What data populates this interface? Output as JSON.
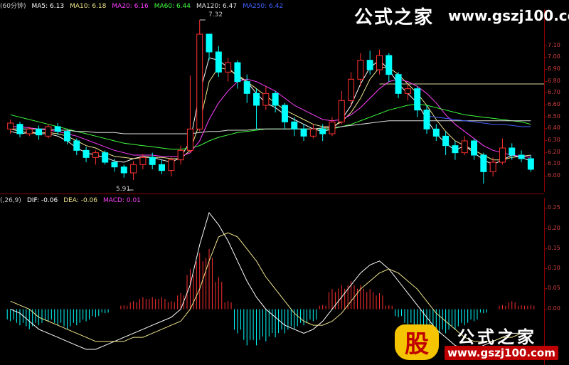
{
  "legend_top": {
    "period": "(60分钟)",
    "items": [
      {
        "label": "MA5: 6.13",
        "color": "#ffffff"
      },
      {
        "label": "MA10: 6.18",
        "color": "#f0e68c"
      },
      {
        "label": "MA20: 6.16",
        "color": "#ff40ff"
      },
      {
        "label": "MA60: 6.44",
        "color": "#40ff40"
      },
      {
        "label": "MA120: 6.47",
        "color": "#e0e0e0"
      },
      {
        "label": "MA250: 6.42",
        "color": "#4060ff"
      }
    ]
  },
  "legend_bottom": {
    "params": "(,26,9)",
    "items": [
      {
        "label": "DIF: -0.06",
        "color": "#ffffff"
      },
      {
        "label": "DEA: -0.06",
        "color": "#f0e68c"
      },
      {
        "label": "MACD: 0.01",
        "color": "#ff40ff"
      }
    ]
  },
  "annotations": {
    "high_label": "7.32",
    "low_label": "5.91"
  },
  "watermark_top": {
    "name": "公式之家",
    "url": "www.gszj100.com"
  },
  "watermark_bottom": {
    "badge": "股",
    "name": "公式之家",
    "url": "www.gszj100.com"
  },
  "colors": {
    "up": "#ff3030",
    "down": "#00ffff",
    "axis": "#8b0000"
  },
  "chart_data": [
    {
      "type": "candlestick",
      "title": "",
      "yticks": [
        "7.10",
        "7.00",
        "6.90",
        "6.80",
        "6.70",
        "6.60",
        "6.50",
        "6.40",
        "6.30",
        "6.20",
        "6.10",
        "6.00"
      ],
      "ylim": [
        5.88,
        7.38
      ],
      "series": [
        {
          "name": "MA5",
          "values": [
            6.38,
            6.36,
            6.37,
            6.36,
            6.36,
            6.34,
            6.3,
            6.24,
            6.2,
            6.18,
            6.16,
            6.13,
            6.12,
            6.15,
            6.17,
            6.16,
            6.14,
            6.12,
            6.16,
            6.3,
            6.7,
            7.0,
            6.98,
            6.92,
            6.84,
            6.8,
            6.7,
            6.62,
            6.58,
            6.52,
            6.48,
            6.44,
            6.4,
            6.38,
            6.4,
            6.48,
            6.6,
            6.78,
            6.92,
            6.98,
            6.9,
            6.78,
            6.7,
            6.62,
            6.48,
            6.36,
            6.28,
            6.22,
            6.26,
            6.2,
            6.14,
            6.1,
            6.14,
            6.18,
            6.16,
            6.13
          ]
        },
        {
          "name": "MA10",
          "values": [
            6.4,
            6.38,
            6.37,
            6.37,
            6.37,
            6.36,
            6.34,
            6.3,
            6.26,
            6.24,
            6.2,
            6.17,
            6.16,
            6.15,
            6.16,
            6.16,
            6.16,
            6.15,
            6.15,
            6.22,
            6.45,
            6.8,
            6.92,
            6.9,
            6.86,
            6.8,
            6.74,
            6.68,
            6.62,
            6.56,
            6.52,
            6.48,
            6.44,
            6.42,
            6.42,
            6.46,
            6.54,
            6.66,
            6.82,
            6.92,
            6.92,
            6.86,
            6.78,
            6.7,
            6.6,
            6.48,
            6.38,
            6.3,
            6.26,
            6.22,
            6.18,
            6.14,
            6.14,
            6.16,
            6.17,
            6.18
          ]
        },
        {
          "name": "MA20",
          "values": [
            6.42,
            6.42,
            6.41,
            6.4,
            6.39,
            6.38,
            6.36,
            6.34,
            6.31,
            6.28,
            6.25,
            6.22,
            6.2,
            6.18,
            6.18,
            6.18,
            6.17,
            6.17,
            6.17,
            6.2,
            6.3,
            6.48,
            6.62,
            6.72,
            6.8,
            6.82,
            6.8,
            6.76,
            6.72,
            6.66,
            6.6,
            6.56,
            6.52,
            6.48,
            6.47,
            6.48,
            6.52,
            6.58,
            6.66,
            6.74,
            6.8,
            6.82,
            6.8,
            6.76,
            6.7,
            6.62,
            6.52,
            6.44,
            6.38,
            6.32,
            6.26,
            6.22,
            6.2,
            6.18,
            6.17,
            6.16
          ]
        },
        {
          "name": "MA60",
          "values": [
            6.52,
            6.5,
            6.48,
            6.46,
            6.44,
            6.42,
            6.4,
            6.38,
            6.36,
            6.34,
            6.32,
            6.3,
            6.28,
            6.27,
            6.26,
            6.25,
            6.24,
            6.23,
            6.23,
            6.24,
            6.26,
            6.3,
            6.33,
            6.35,
            6.37,
            6.38,
            6.39,
            6.4,
            6.4,
            6.4,
            6.4,
            6.4,
            6.4,
            6.4,
            6.4,
            6.42,
            6.44,
            6.47,
            6.5,
            6.53,
            6.56,
            6.58,
            6.6,
            6.61,
            6.6,
            6.58,
            6.56,
            6.54,
            6.52,
            6.51,
            6.5,
            6.49,
            6.48,
            6.47,
            6.46,
            6.44
          ]
        },
        {
          "name": "MA120",
          "values": [
            6.4,
            6.4,
            6.4,
            6.4,
            6.4,
            6.39,
            6.39,
            6.38,
            6.38,
            6.37,
            6.37,
            6.37,
            6.36,
            6.36,
            6.36,
            6.36,
            6.36,
            6.36,
            6.36,
            6.36,
            6.37,
            6.38,
            6.38,
            6.39,
            6.39,
            6.39,
            6.4,
            6.4,
            6.4,
            6.4,
            6.4,
            6.4,
            6.4,
            6.41,
            6.41,
            6.42,
            6.43,
            6.44,
            6.45,
            6.46,
            6.47,
            6.47,
            6.47,
            6.47,
            6.47,
            6.47,
            6.47,
            6.47,
            6.47,
            6.47,
            6.47,
            6.47,
            6.47,
            6.47,
            6.47,
            6.47
          ]
        },
        {
          "name": "MA250",
          "values": [
            null,
            null,
            null,
            null,
            null,
            null,
            null,
            null,
            null,
            null,
            null,
            null,
            null,
            null,
            null,
            null,
            null,
            null,
            null,
            null,
            null,
            null,
            null,
            null,
            null,
            null,
            null,
            null,
            null,
            null,
            null,
            null,
            null,
            null,
            null,
            null,
            null,
            null,
            null,
            null,
            null,
            null,
            null,
            null,
            6.51,
            6.5,
            6.49,
            6.48,
            6.47,
            6.46,
            6.45,
            6.44,
            6.44,
            6.43,
            6.42,
            6.42
          ]
        }
      ],
      "candles": [
        [
          6.4,
          6.45,
          6.48,
          6.36
        ],
        [
          6.44,
          6.36,
          6.46,
          6.33
        ],
        [
          6.36,
          6.4,
          6.42,
          6.34
        ],
        [
          6.4,
          6.35,
          6.43,
          6.31
        ],
        [
          6.34,
          6.42,
          6.44,
          6.32
        ],
        [
          6.42,
          6.38,
          6.45,
          6.35
        ],
        [
          6.38,
          6.3,
          6.4,
          6.27
        ],
        [
          6.3,
          6.22,
          6.32,
          6.18
        ],
        [
          6.22,
          6.16,
          6.25,
          6.12
        ],
        [
          6.16,
          6.2,
          6.22,
          6.1
        ],
        [
          6.2,
          6.12,
          6.22,
          6.1
        ],
        [
          6.12,
          6.08,
          6.15,
          6.04
        ],
        [
          6.08,
          6.03,
          6.1,
          5.99
        ],
        [
          6.03,
          6.1,
          6.13,
          5.97
        ],
        [
          6.1,
          6.16,
          6.19,
          6.06
        ],
        [
          6.16,
          6.1,
          6.2,
          6.06
        ],
        [
          6.1,
          6.05,
          6.14,
          6.02
        ],
        [
          6.05,
          6.14,
          6.16,
          6.0
        ],
        [
          6.14,
          6.22,
          6.26,
          6.1
        ],
        [
          6.22,
          6.4,
          6.85,
          6.2
        ],
        [
          6.4,
          7.2,
          7.32,
          6.38
        ],
        [
          7.2,
          7.05,
          7.14,
          6.98
        ],
        [
          7.05,
          6.88,
          7.1,
          6.84
        ],
        [
          6.88,
          6.96,
          7.0,
          6.8
        ],
        [
          6.96,
          6.8,
          6.98,
          6.74
        ],
        [
          6.8,
          6.7,
          6.86,
          6.62
        ],
        [
          6.7,
          6.6,
          6.74,
          6.4
        ],
        [
          6.6,
          6.7,
          6.76,
          6.56
        ],
        [
          6.7,
          6.6,
          6.72,
          6.54
        ],
        [
          6.6,
          6.46,
          6.62,
          6.4
        ],
        [
          6.46,
          6.4,
          6.5,
          6.34
        ],
        [
          6.4,
          6.34,
          6.44,
          6.3
        ],
        [
          6.34,
          6.4,
          6.44,
          6.32
        ],
        [
          6.4,
          6.36,
          6.44,
          6.3
        ],
        [
          6.36,
          6.46,
          6.5,
          6.34
        ],
        [
          6.46,
          6.64,
          6.72,
          6.44
        ],
        [
          6.64,
          6.82,
          6.88,
          6.6
        ],
        [
          6.82,
          6.98,
          7.04,
          6.76
        ],
        [
          6.98,
          6.9,
          7.06,
          6.86
        ],
        [
          6.9,
          7.02,
          7.07,
          6.86
        ],
        [
          7.02,
          6.86,
          7.04,
          6.8
        ],
        [
          6.86,
          6.7,
          6.88,
          6.66
        ],
        [
          6.7,
          6.74,
          6.78,
          6.64
        ],
        [
          6.74,
          6.56,
          6.76,
          6.5
        ],
        [
          6.56,
          6.4,
          6.6,
          6.36
        ],
        [
          6.4,
          6.34,
          6.44,
          6.3
        ],
        [
          6.34,
          6.26,
          6.38,
          6.18
        ],
        [
          6.26,
          6.2,
          6.3,
          6.14
        ],
        [
          6.2,
          6.3,
          6.34,
          6.18
        ],
        [
          6.3,
          6.18,
          6.32,
          6.14
        ],
        [
          6.18,
          6.04,
          6.2,
          5.94
        ],
        [
          6.04,
          6.12,
          6.16,
          6.0
        ],
        [
          6.12,
          6.24,
          6.32,
          6.1
        ],
        [
          6.24,
          6.18,
          6.28,
          6.14
        ],
        [
          6.18,
          6.15,
          6.22,
          6.12
        ],
        [
          6.15,
          6.06,
          6.18,
          6.04
        ]
      ],
      "level_line": 6.78
    },
    {
      "type": "macd",
      "title": "",
      "yticks": [
        "0.25",
        "0.20",
        "0.15",
        "0.10",
        "0.05",
        "0.00"
      ],
      "ylim": [
        -0.13,
        0.27
      ],
      "series": [
        {
          "name": "DIF",
          "values": [
            0.0,
            -0.01,
            -0.03,
            -0.05,
            -0.06,
            -0.07,
            -0.08,
            -0.09,
            -0.1,
            -0.1,
            -0.09,
            -0.08,
            -0.07,
            -0.06,
            -0.05,
            -0.04,
            -0.03,
            -0.02,
            0.0,
            0.06,
            0.16,
            0.24,
            0.21,
            0.17,
            0.12,
            0.07,
            0.03,
            0.0,
            -0.02,
            -0.04,
            -0.05,
            -0.06,
            -0.05,
            -0.03,
            0.0,
            0.03,
            0.06,
            0.09,
            0.11,
            0.12,
            0.1,
            0.07,
            0.04,
            0.01,
            -0.02,
            -0.05,
            -0.07,
            -0.09,
            -0.1,
            -0.1,
            -0.09,
            -0.08,
            -0.07,
            -0.06,
            -0.06,
            -0.06
          ]
        },
        {
          "name": "DEA",
          "values": [
            0.02,
            0.01,
            0.0,
            -0.02,
            -0.03,
            -0.04,
            -0.05,
            -0.06,
            -0.07,
            -0.08,
            -0.08,
            -0.08,
            -0.08,
            -0.07,
            -0.07,
            -0.06,
            -0.05,
            -0.04,
            -0.03,
            0.0,
            0.05,
            0.12,
            0.18,
            0.19,
            0.18,
            0.15,
            0.12,
            0.08,
            0.05,
            0.02,
            -0.01,
            -0.03,
            -0.04,
            -0.04,
            -0.03,
            -0.01,
            0.02,
            0.05,
            0.07,
            0.09,
            0.1,
            0.09,
            0.07,
            0.05,
            0.02,
            -0.01,
            -0.03,
            -0.05,
            -0.07,
            -0.08,
            -0.08,
            -0.08,
            -0.07,
            -0.07,
            -0.06,
            -0.06
          ]
        }
      ],
      "histogram": [
        -0.03,
        -0.04,
        -0.05,
        -0.04,
        -0.03,
        -0.04,
        -0.05,
        -0.04,
        -0.03,
        -0.02,
        -0.01,
        0.0,
        0.01,
        0.02,
        0.03,
        0.03,
        0.03,
        0.02,
        0.04,
        0.1,
        0.14,
        0.15,
        0.08,
        0.02,
        -0.06,
        -0.09,
        -0.09,
        -0.08,
        -0.07,
        -0.06,
        -0.05,
        -0.04,
        -0.03,
        0.01,
        0.05,
        0.06,
        0.07,
        0.06,
        0.05,
        0.04,
        0.01,
        -0.02,
        -0.04,
        -0.05,
        -0.06,
        -0.07,
        -0.06,
        -0.05,
        -0.04,
        -0.03,
        -0.01,
        0.0,
        0.01,
        0.02,
        0.01,
        0.01
      ]
    }
  ]
}
